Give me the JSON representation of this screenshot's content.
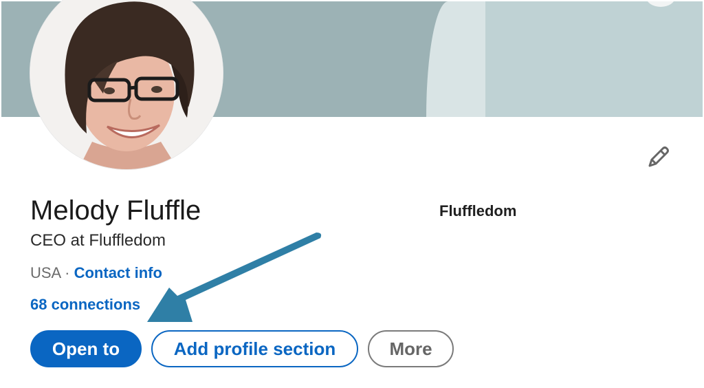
{
  "profile": {
    "name": "Melody Fluffle",
    "headline": "CEO at Fluffledom",
    "company": "Fluffledom",
    "location": "USA",
    "separator": "·",
    "contact_info_label": "Contact info",
    "connections_label": "68 connections"
  },
  "actions": {
    "open_to_label": "Open to",
    "add_section_label": "Add profile section",
    "more_label": "More"
  },
  "icons": {
    "edit": "pencil-icon",
    "annotation": "arrow-icon"
  },
  "colors": {
    "accent": "#0a66c2",
    "annotation_arrow": "#2f7fa6",
    "banner": "#9cb2b5"
  }
}
